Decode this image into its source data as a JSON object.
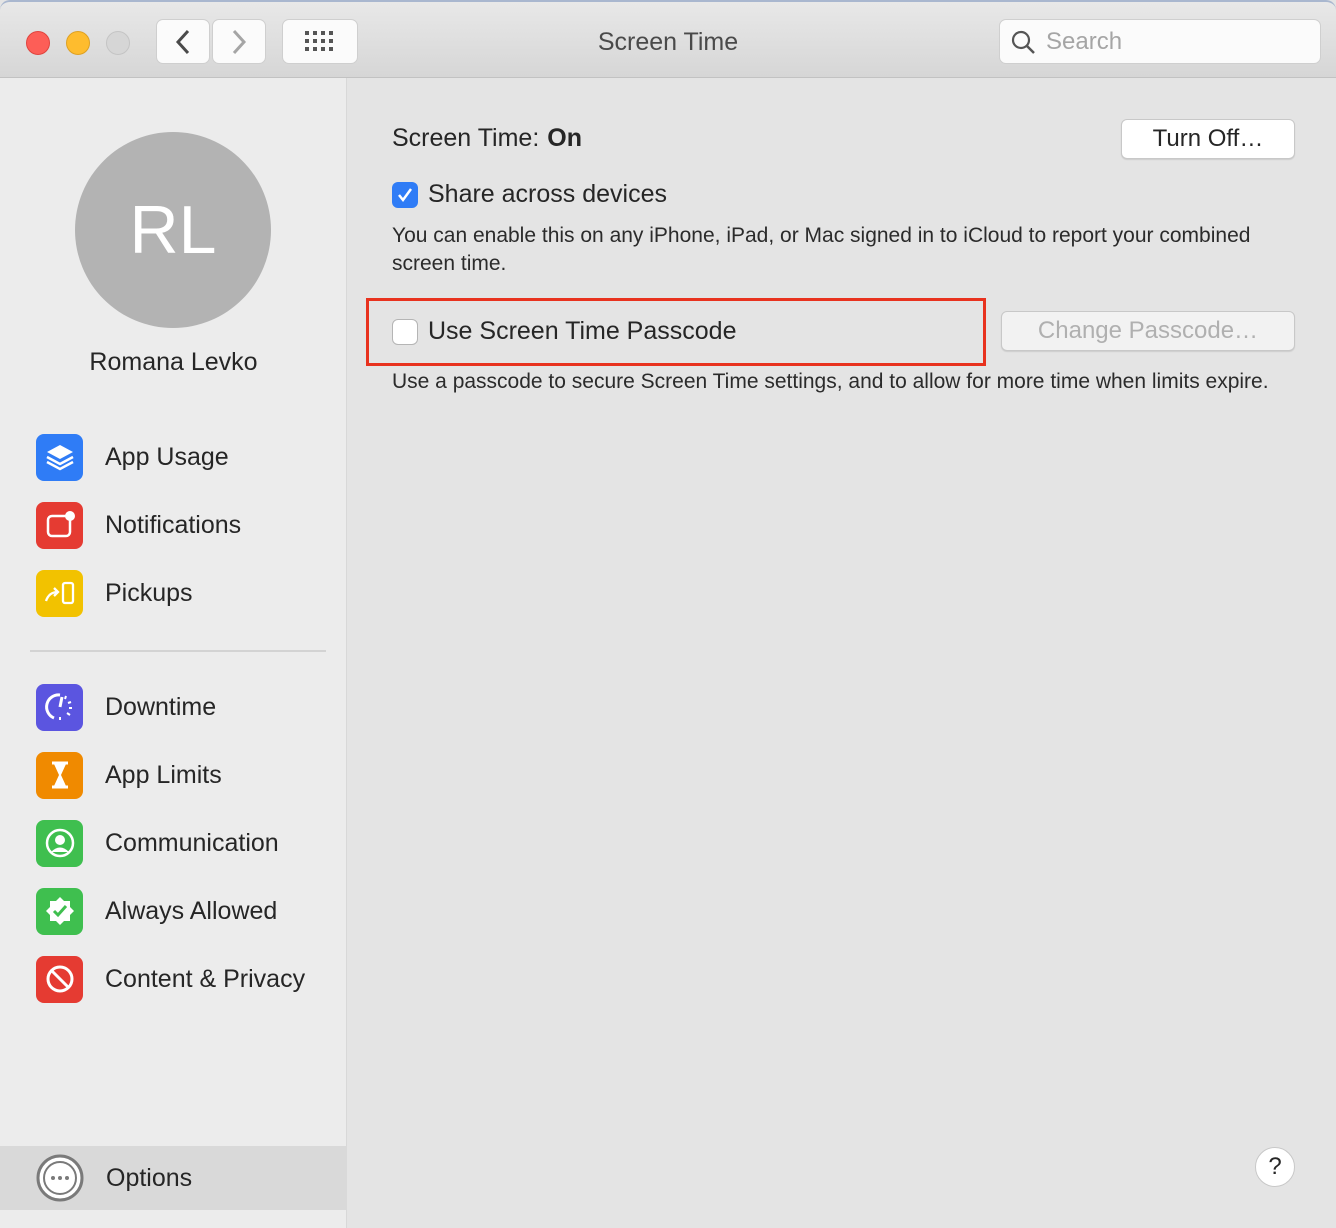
{
  "window": {
    "title": "Screen Time",
    "search_placeholder": "Search"
  },
  "user": {
    "initials": "RL",
    "name": "Romana Levko"
  },
  "sidebar": {
    "items": [
      {
        "label": "App Usage",
        "icon": "layers-icon",
        "color": "#2f7cf6"
      },
      {
        "label": "Notifications",
        "icon": "notification-icon",
        "color": "#e53b32"
      },
      {
        "label": "Pickups",
        "icon": "pickup-icon",
        "color": "#f2c200"
      },
      {
        "label": "Downtime",
        "icon": "downtime-icon",
        "color": "#5b55e0"
      },
      {
        "label": "App Limits",
        "icon": "hourglass-icon",
        "color": "#f08a00"
      },
      {
        "label": "Communication",
        "icon": "person-circle-icon",
        "color": "#3fbf4f"
      },
      {
        "label": "Always Allowed",
        "icon": "checkmark-badge-icon",
        "color": "#3fbf4f"
      },
      {
        "label": "Content & Privacy",
        "icon": "prohibited-icon",
        "color": "#e53b32"
      }
    ],
    "options_label": "Options"
  },
  "main": {
    "status_label": "Screen Time:",
    "status_value": "On",
    "turn_off": "Turn Off…",
    "share_label": "Share across devices",
    "share_checked": true,
    "share_desc": "You can enable this on any iPhone, iPad, or Mac signed in to iCloud to report your combined screen time.",
    "passcode_label": "Use Screen Time Passcode",
    "passcode_checked": false,
    "change_passcode": "Change Passcode…",
    "passcode_desc": "Use a passcode to secure Screen Time settings, and to allow for more time when limits expire.",
    "help": "?"
  }
}
